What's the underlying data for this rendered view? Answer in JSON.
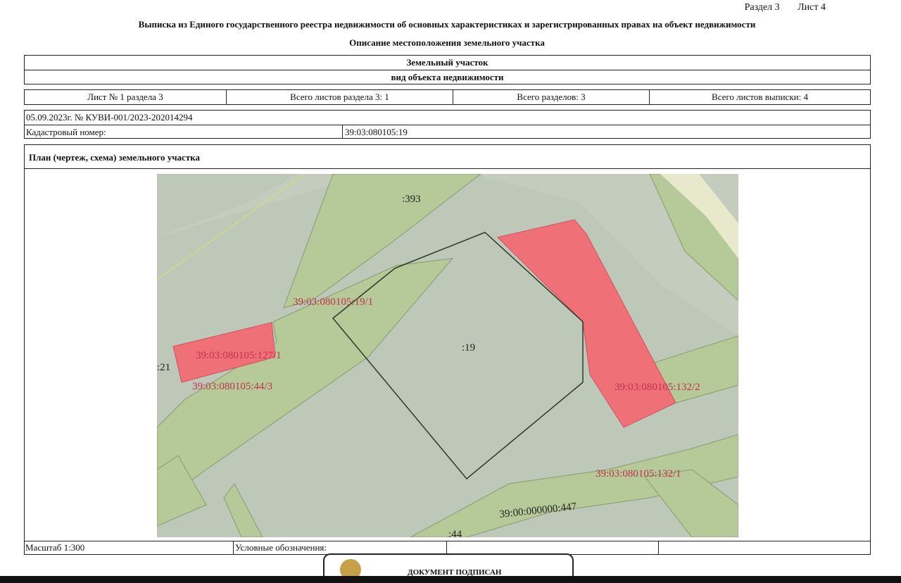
{
  "header": {
    "section": "Раздел 3",
    "sheet": "Лист 4",
    "title": "Выписка из Единого государственного реестра недвижимости об основных характеристиках и зарегистрированных правах на объект недвижимости",
    "subtitle": "Описание местоположения земельного участка"
  },
  "object": {
    "name": "Земельный участок",
    "kind_label": "вид объекта недвижимости"
  },
  "sheets": {
    "sheet_no": "Лист № 1 раздела 3",
    "total_section_sheets": "Всего листов раздела 3: 1",
    "total_sections": "Всего разделов: 3",
    "total_extract_sheets": "Всего листов выписки: 4"
  },
  "record": {
    "date_number": "05.09.2023г. № КУВИ-001/2023-202014294",
    "cadastral_label": "Кадастровый номер:",
    "cadastral_value": "39:03:080105:19"
  },
  "plan": {
    "title": "План (чертеж, схема) земельного участка",
    "labels": {
      "l393": ":393",
      "l19_1": "39:03:080105:19/1",
      "l19": ":19",
      "l127_1": "39:03:080105:127/1",
      "l21": ":21",
      "l44_3": "39:03:080105:44/3",
      "l132_2": "39:03:080105:132/2",
      "l132_1": "39:03:080105:132/1",
      "l447": "39:00:000000:447",
      "l44": ":44"
    }
  },
  "footer": {
    "scale": "Масштаб 1:300",
    "legend": "Условные обозначения:",
    "signed": "ДОКУМЕНТ ПОДПИСАН"
  },
  "colors": {
    "map_base": "#bec8b8",
    "parcel_green": "#b6c998",
    "zone_red": "#f07078",
    "label_red": "#c03050"
  }
}
